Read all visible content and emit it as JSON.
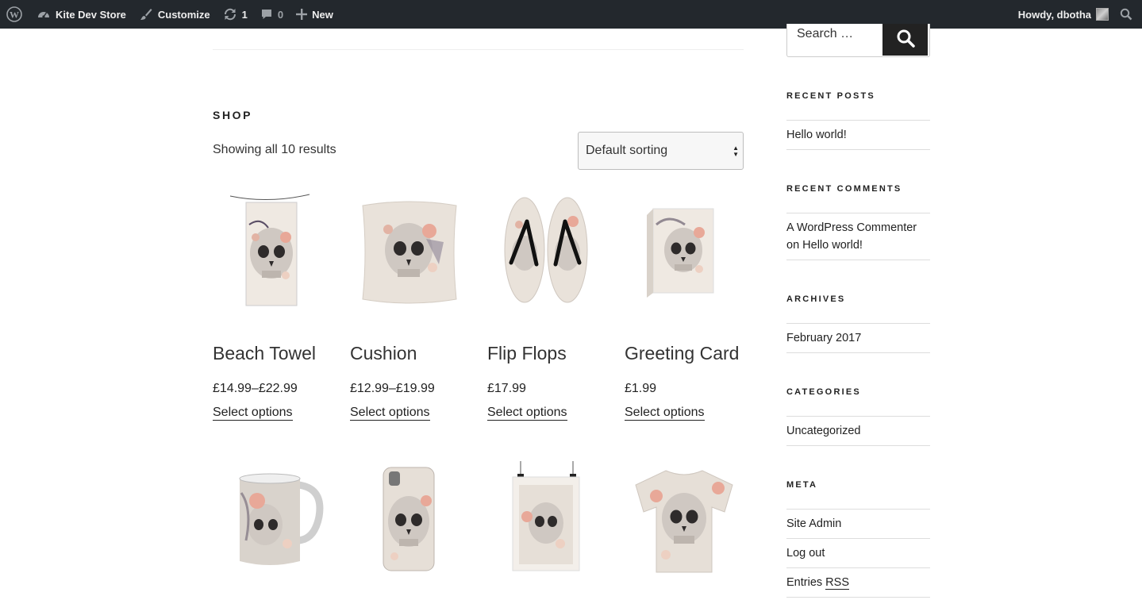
{
  "adminbar": {
    "site_name": "Kite Dev Store",
    "customize": "Customize",
    "updates_count": "1",
    "comments_count": "0",
    "new_label": "New",
    "howdy": "Howdy, dbotha"
  },
  "shop": {
    "title": "SHOP",
    "result_count": "Showing all 10 results",
    "ordering_selected": "Default sorting"
  },
  "products": [
    {
      "name": "Beach Towel",
      "price": "£14.99–£22.99",
      "button": "Select options"
    },
    {
      "name": "Cushion",
      "price": "£12.99–£19.99",
      "button": "Select options"
    },
    {
      "name": "Flip Flops",
      "price": "£17.99",
      "button": "Select options"
    },
    {
      "name": "Greeting Card",
      "price": "£1.99",
      "button": "Select options"
    }
  ],
  "sidebar": {
    "search_placeholder": "Search …",
    "recent_posts_title": "RECENT POSTS",
    "recent_posts": [
      "Hello world!"
    ],
    "recent_comments_title": "RECENT COMMENTS",
    "recent_comment_author": "A WordPress Commenter",
    "recent_comment_on": "on",
    "recent_comment_post": "Hello world!",
    "archives_title": "ARCHIVES",
    "archives": [
      "February 2017"
    ],
    "categories_title": "CATEGORIES",
    "categories": [
      "Uncategorized"
    ],
    "meta_title": "META",
    "meta": [
      "Site Admin",
      "Log out",
      "Entries"
    ],
    "meta_rss": "RSS"
  },
  "colors": {
    "adminbar_bg": "#23282d",
    "search_button_bg": "#222222",
    "skull_accent": "#e8a898"
  },
  "icons": [
    "wordpress-icon",
    "dashboard-icon",
    "brush-icon",
    "updates-icon",
    "comment-icon",
    "plus-icon",
    "search-icon"
  ]
}
